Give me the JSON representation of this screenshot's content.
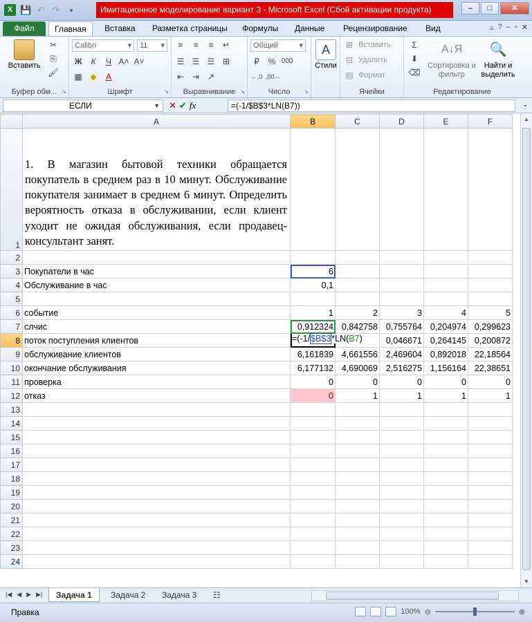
{
  "window": {
    "title": "Имитационное моделирование вариант 3  -  Microsoft Excel (Сбой активации продукта)",
    "app_icon": "X"
  },
  "ribbon_tabs": [
    "Файл",
    "Главная",
    "Вставка",
    "Разметка страницы",
    "Формулы",
    "Данные",
    "Рецензирование",
    "Вид"
  ],
  "ribbon": {
    "clipboard": {
      "paste_label": "Вставить",
      "group_label": "Буфер обм..."
    },
    "font": {
      "font_name": "Calibri",
      "font_size": "11",
      "bold": "Ж",
      "italic": "К",
      "underline": "Ч",
      "group_label": "Шрифт"
    },
    "alignment": {
      "group_label": "Выравнивание"
    },
    "number": {
      "format": "Общий",
      "percent": "%",
      "thousands": "000",
      "group_label": "Число"
    },
    "styles": {
      "label": "Стили"
    },
    "cells": {
      "insert": "Вставить",
      "delete": "Удалить",
      "format": "Формат",
      "group_label": "Ячейки"
    },
    "editing": {
      "sort_label": "Сортировка и фильтр",
      "find_label": "Найти и выделить",
      "group_label": "Редактирование"
    }
  },
  "formula_bar": {
    "name_box": "ЕСЛИ",
    "fx": "fx",
    "formula": "=(-1/$B$3*LN(B7))"
  },
  "sheet": {
    "columns": [
      "A",
      "B",
      "C",
      "D",
      "E",
      "F"
    ],
    "description": "1. В магазин бытовой техники обращается покупатель в среднем раз в 10 минут. Обслуживание покупателя занимает в среднем 6 минут. Определить вероятность отказа в обслуживании, если клиент уходит не ожидая обслуживания, если продавец-консультант занят.",
    "rows": [
      {
        "n": "3",
        "label": "Покупатели в час",
        "values": [
          "6",
          "",
          "",
          "",
          ""
        ]
      },
      {
        "n": "4",
        "label": "Обслуживание в час",
        "values": [
          "0,1",
          "",
          "",
          "",
          ""
        ]
      },
      {
        "n": "6",
        "label": "событие",
        "values": [
          "1",
          "2",
          "3",
          "4",
          "5"
        ]
      },
      {
        "n": "7",
        "label": "слчис",
        "values": [
          "0,912324",
          "0,842758",
          "0,755764",
          "0,204974",
          "0,299623"
        ]
      },
      {
        "n": "8",
        "label": "поток поступления клиентов",
        "values": [
          "",
          "",
          "0,046671",
          "0,264145",
          "0,200872"
        ]
      },
      {
        "n": "9",
        "label": "обслуживание клиентов",
        "values": [
          "6,161839",
          "4,661556",
          "2,469604",
          "0,892018",
          "22,18564"
        ]
      },
      {
        "n": "10",
        "label": "окончание обслуживания",
        "values": [
          "6,177132",
          "4,690069",
          "2,516275",
          "1,156164",
          "22,38651"
        ]
      },
      {
        "n": "11",
        "label": "проверка",
        "values": [
          "0",
          "0",
          "0",
          "0",
          "0"
        ]
      },
      {
        "n": "12",
        "label": "отказ",
        "values": [
          "0",
          "1",
          "1",
          "1",
          "1"
        ]
      }
    ],
    "edit_cell": {
      "p1": "=(-1/",
      "ref1": "$B$3",
      "p2": "*LN(",
      "ref2": "B7",
      "p3": ")"
    }
  },
  "sheet_tabs": [
    "Задача 1",
    "Задача 2",
    "Задача 3"
  ],
  "status": {
    "ready": "Правка",
    "zoom": "100%"
  }
}
